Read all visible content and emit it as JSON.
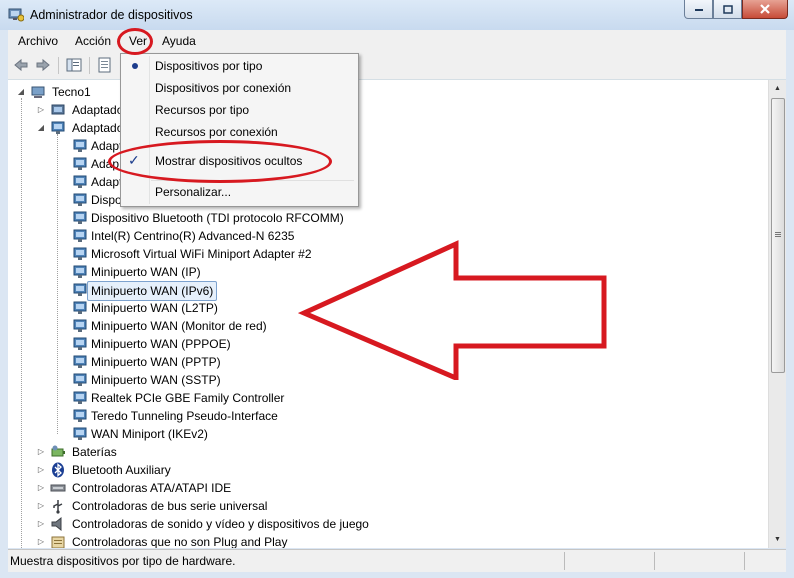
{
  "window": {
    "title": "Administrador de dispositivos",
    "controls": [
      "minimize-icon",
      "maximize-icon",
      "close-icon"
    ]
  },
  "menubar": {
    "items": [
      "Archivo",
      "Acción",
      "Ver",
      "Ayuda"
    ],
    "active": "Ver"
  },
  "toolbar": {
    "icons": [
      "back-arrow-icon",
      "forward-arrow-icon",
      "show-hide-console-tree-icon",
      "properties-icon"
    ]
  },
  "view_menu": {
    "items": [
      {
        "label": "Dispositivos por tipo",
        "state": "radio-selected"
      },
      {
        "label": "Dispositivos por conexión",
        "state": "none"
      },
      {
        "label": "Recursos por tipo",
        "state": "none"
      },
      {
        "label": "Recursos por conexión",
        "state": "none"
      },
      {
        "label": "Mostrar dispositivos ocultos",
        "state": "checked"
      },
      {
        "label": "Personalizar...",
        "state": "none"
      }
    ]
  },
  "tree": {
    "root": "Tecno1",
    "categories_top": [
      "Adaptado",
      "Adaptado"
    ],
    "network_adapters_partial": [
      "Adapt",
      "Adap",
      "Adapt",
      "Dispo"
    ],
    "network_adapters": [
      "Dispositivo Bluetooth (TDI protocolo RFCOMM)",
      "Intel(R) Centrino(R) Advanced-N 6235",
      "Microsoft Virtual WiFi Miniport Adapter #2",
      "Minipuerto WAN (IP)",
      "Minipuerto WAN (IPv6)",
      "Minipuerto WAN (L2TP)",
      "Minipuerto WAN (Monitor de red)",
      "Minipuerto WAN (PPPOE)",
      "Minipuerto WAN (PPTP)",
      "Minipuerto WAN (SSTP)",
      "Realtek PCIe GBE Family Controller",
      "Teredo Tunneling Pseudo-Interface",
      "WAN Miniport (IKEv2)"
    ],
    "selected": "Minipuerto WAN (IPv6)",
    "categories_bottom": [
      "Baterías",
      "Bluetooth Auxiliary",
      "Controladoras ATA/ATAPI IDE",
      "Controladoras de bus serie universal",
      "Controladoras de sonido y vídeo y dispositivos de juego",
      "Controladoras que no son Plug and Play"
    ]
  },
  "statusbar": {
    "text": "Muestra dispositivos por tipo de hardware."
  },
  "annotation": {
    "color": "#d71920",
    "shapes": [
      "oval-around-ver-menu",
      "oval-around-mostrar-dispositivos-ocultos",
      "arrow-pointing-left-at-minipuerto-wan-ipv6"
    ]
  }
}
